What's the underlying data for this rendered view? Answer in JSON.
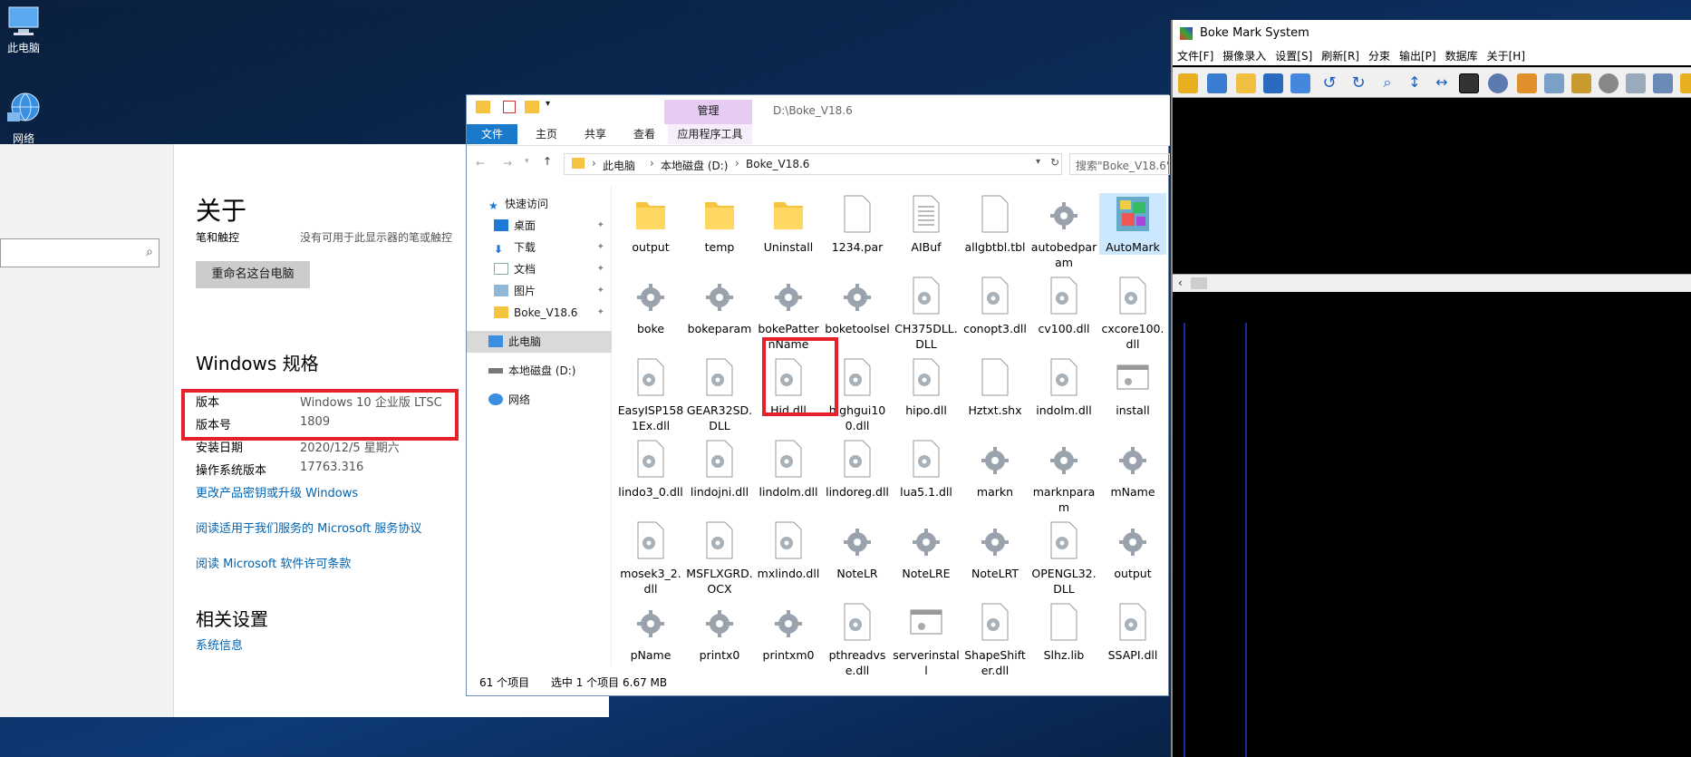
{
  "desktop": {
    "icons": [
      {
        "label": "此电脑"
      },
      {
        "label": "网络"
      }
    ]
  },
  "settings": {
    "title": "关于",
    "partial_label": "笔和触控",
    "partial_value": "没有可用于此显示器的笔或触控",
    "rename_button": "重命名这台电脑",
    "spec_heading": "Windows 规格",
    "specs": [
      {
        "label": "版本",
        "value": "Windows 10 企业版 LTSC"
      },
      {
        "label": "版本号",
        "value": "1809"
      },
      {
        "label": "安装日期",
        "value": "2020/12/5 星期六"
      },
      {
        "label": "操作系统版本",
        "value": "17763.316"
      }
    ],
    "links": [
      "更改产品密钥或升级 Windows",
      "阅读适用于我们服务的 Microsoft 服务协议",
      "阅读 Microsoft 软件许可条款"
    ],
    "related_heading": "相关设置",
    "related_link": "系统信息",
    "highlight_color": "#e5202b"
  },
  "explorer": {
    "path_title": "D:\\Boke_V18.6",
    "context_tab": "管理",
    "tabs": [
      "文件",
      "主页",
      "共享",
      "查看",
      "应用程序工具"
    ],
    "breadcrumb": [
      "此电脑",
      "本地磁盘 (D:)",
      "Boke_V18.6"
    ],
    "search_placeholder": "搜索\"Boke_V18.6\"",
    "nav": {
      "quick_access": "快速访问",
      "pinned": [
        "桌面",
        "下载",
        "文档",
        "图片",
        "Boke_V18.6"
      ],
      "this_pc": "此电脑",
      "drive": "本地磁盘 (D:)",
      "network": "网络"
    },
    "files": [
      {
        "name": "output",
        "type": "folder"
      },
      {
        "name": "temp",
        "type": "folder"
      },
      {
        "name": "Uninstall",
        "type": "folder"
      },
      {
        "name": "1234.par",
        "type": "doc"
      },
      {
        "name": "AIBuf",
        "type": "text"
      },
      {
        "name": "allgbtbl.tbl",
        "type": "doc"
      },
      {
        "name": "autobedparam",
        "type": "gear"
      },
      {
        "name": "AutoMark",
        "type": "app"
      },
      {
        "name": "boke",
        "type": "gear"
      },
      {
        "name": "bokeparam",
        "type": "gear"
      },
      {
        "name": "bokePatternName",
        "type": "gear"
      },
      {
        "name": "boketoolsel",
        "type": "gear"
      },
      {
        "name": "CH375DLL.DLL",
        "type": "dll"
      },
      {
        "name": "conopt3.dll",
        "type": "dll"
      },
      {
        "name": "cv100.dll",
        "type": "dll"
      },
      {
        "name": "cxcore100.dll",
        "type": "dll"
      },
      {
        "name": "EasyISP1581Ex.dll",
        "type": "dll"
      },
      {
        "name": "GEAR32SD.DLL",
        "type": "dll"
      },
      {
        "name": "Hid.dll",
        "type": "dll"
      },
      {
        "name": "highgui100.dll",
        "type": "dll"
      },
      {
        "name": "hipo.dll",
        "type": "dll"
      },
      {
        "name": "Hztxt.shx",
        "type": "doc"
      },
      {
        "name": "indolm.dll",
        "type": "dll"
      },
      {
        "name": "install",
        "type": "window"
      },
      {
        "name": "lindo3_0.dll",
        "type": "dll"
      },
      {
        "name": "lindojni.dll",
        "type": "dll"
      },
      {
        "name": "lindolm.dll",
        "type": "dll"
      },
      {
        "name": "lindoreg.dll",
        "type": "dll"
      },
      {
        "name": "lua5.1.dll",
        "type": "dll"
      },
      {
        "name": "markn",
        "type": "gear"
      },
      {
        "name": "marknparam",
        "type": "gear"
      },
      {
        "name": "mName",
        "type": "gear"
      },
      {
        "name": "mosek3_2.dll",
        "type": "dll"
      },
      {
        "name": "MSFLXGRD.OCX",
        "type": "dll"
      },
      {
        "name": "mxlindo.dll",
        "type": "dll"
      },
      {
        "name": "NoteLR",
        "type": "gear"
      },
      {
        "name": "NoteLRE",
        "type": "gear"
      },
      {
        "name": "NoteLRT",
        "type": "gear"
      },
      {
        "name": "OPENGL32.DLL",
        "type": "dll"
      },
      {
        "name": "output",
        "type": "gear"
      },
      {
        "name": "pName",
        "type": "gear"
      },
      {
        "name": "printx0",
        "type": "gear"
      },
      {
        "name": "printxm0",
        "type": "gear"
      },
      {
        "name": "pthreadvse.dll",
        "type": "dll"
      },
      {
        "name": "serverinstall",
        "type": "window"
      },
      {
        "name": "ShapeShifter.dll",
        "type": "dll"
      },
      {
        "name": "Slhz.lib",
        "type": "doc"
      },
      {
        "name": "SSAPI.dll",
        "type": "dll"
      }
    ],
    "highlighted_file": "Hid.dll",
    "status": {
      "count": "61 个项目",
      "selection": "选中 1 个项目  6.67 MB"
    }
  },
  "boke": {
    "title": "Boke Mark System",
    "menu": [
      "文件[F]",
      "摄像录入",
      "设置[S]",
      "刷新[R]",
      "分束",
      "输出[P]",
      "数据库",
      "关于[H]"
    ]
  }
}
